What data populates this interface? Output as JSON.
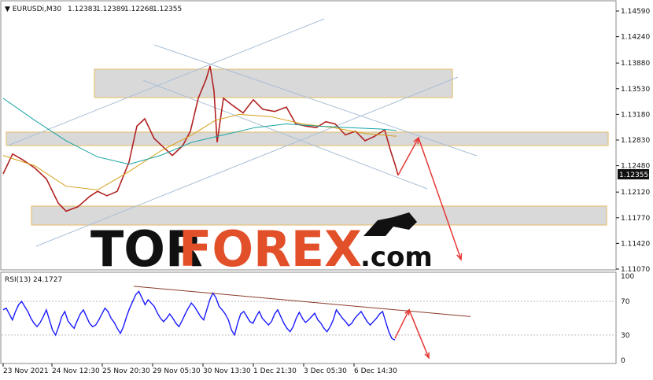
{
  "chart_data": [
    {
      "type": "line",
      "title": "EURUSDi,M30",
      "header": {
        "symbol": "EURUSDi,M30",
        "open": "1.12383",
        "high": "1.12389",
        "low": "1.12268",
        "close": "1.12355"
      },
      "current_price_label": "1.12355",
      "ylim": [
        1.1107,
        1.1459
      ],
      "y_ticks": [
        "1.14590",
        "1.14240",
        "1.13880",
        "1.13530",
        "1.13180",
        "1.12830",
        "1.12480",
        "1.12120",
        "1.11770",
        "1.11420",
        "1.11070"
      ],
      "x_ticks": [
        "23 Nov 2021",
        "24 Nov 12:30",
        "25 Nov 20:30",
        "29 Nov 05:30",
        "30 Nov 13:30",
        "1 Dec 21:30",
        "3 Dec 05:30",
        "6 Dec 14:30"
      ],
      "series": [
        {
          "name": "",
          "kind": "price",
          "color": "#b22222",
          "points": [
            [
              0,
              1.1237
            ],
            [
              12,
              1.1264
            ],
            [
              25,
              1.1256
            ],
            [
              40,
              1.1245
            ],
            [
              55,
              1.123
            ],
            [
              70,
              1.1197
            ],
            [
              80,
              1.1186
            ],
            [
              95,
              1.1192
            ],
            [
              110,
              1.1206
            ],
            [
              120,
              1.1213
            ],
            [
              132,
              1.1207
            ],
            [
              145,
              1.1213
            ],
            [
              160,
              1.1253
            ],
            [
              170,
              1.1302
            ],
            [
              180,
              1.1312
            ],
            [
              192,
              1.1285
            ],
            [
              205,
              1.1272
            ],
            [
              215,
              1.1262
            ],
            [
              228,
              1.1275
            ],
            [
              238,
              1.1295
            ],
            [
              248,
              1.134
            ],
            [
              258,
              1.1366
            ],
            [
              263,
              1.1384
            ],
            [
              268,
              1.135
            ],
            [
              272,
              1.128
            ],
            [
              280,
              1.134
            ],
            [
              292,
              1.133
            ],
            [
              305,
              1.132
            ],
            [
              318,
              1.1338
            ],
            [
              330,
              1.1325
            ],
            [
              345,
              1.1322
            ],
            [
              360,
              1.1328
            ],
            [
              372,
              1.1305
            ],
            [
              385,
              1.1302
            ],
            [
              398,
              1.13
            ],
            [
              410,
              1.1308
            ],
            [
              422,
              1.1305
            ],
            [
              435,
              1.129
            ],
            [
              448,
              1.1295
            ],
            [
              460,
              1.1282
            ],
            [
              472,
              1.1288
            ],
            [
              485,
              1.1297
            ],
            [
              492,
              1.127
            ],
            [
              498,
              1.125
            ],
            [
              502,
              1.1235
            ]
          ]
        },
        {
          "name": "",
          "kind": "ma-fast",
          "color": "#d4a017",
          "points": [
            [
              0,
              1.1262
            ],
            [
              40,
              1.1248
            ],
            [
              80,
              1.122
            ],
            [
              120,
              1.1215
            ],
            [
              160,
              1.124
            ],
            [
              200,
              1.1268
            ],
            [
              240,
              1.129
            ],
            [
              270,
              1.131
            ],
            [
              300,
              1.1318
            ],
            [
              340,
              1.1315
            ],
            [
              380,
              1.1305
            ],
            [
              420,
              1.13
            ],
            [
              460,
              1.1292
            ],
            [
              500,
              1.1288
            ]
          ]
        },
        {
          "name": "",
          "kind": "ma-slow",
          "color": "#1aa3a3",
          "points": [
            [
              0,
              1.134
            ],
            [
              40,
              1.131
            ],
            [
              80,
              1.1282
            ],
            [
              120,
              1.126
            ],
            [
              160,
              1.125
            ],
            [
              200,
              1.1262
            ],
            [
              240,
              1.128
            ],
            [
              280,
              1.129
            ],
            [
              320,
              1.13
            ],
            [
              360,
              1.1305
            ],
            [
              400,
              1.1302
            ],
            [
              440,
              1.13
            ],
            [
              480,
              1.1298
            ],
            [
              500,
              1.1296
            ]
          ]
        }
      ],
      "projection": {
        "color": "#e53935",
        "points": [
          [
            502,
            1.1235
          ],
          [
            528,
            1.1286
          ],
          [
            582,
            1.112
          ]
        ]
      }
    },
    {
      "type": "line",
      "title": "RSI(13) 24.1727",
      "ylim": [
        0,
        100
      ],
      "y_ticks": [
        "100",
        "70",
        "30",
        "0"
      ],
      "series": [
        {
          "name": "RSI(13)",
          "color": "#1a1aff",
          "values": [
            60,
            62,
            55,
            48,
            58,
            66,
            70,
            64,
            58,
            50,
            44,
            40,
            45,
            52,
            60,
            48,
            36,
            30,
            40,
            52,
            58,
            47,
            42,
            38,
            47,
            55,
            60,
            52,
            44,
            40,
            42,
            48,
            55,
            62,
            58,
            50,
            45,
            38,
            32,
            40,
            52,
            62,
            70,
            78,
            82,
            74,
            66,
            72,
            68,
            64,
            56,
            50,
            46,
            50,
            55,
            50,
            44,
            40,
            47,
            55,
            62,
            68,
            64,
            58,
            52,
            48,
            60,
            72,
            80,
            74,
            64,
            60,
            55,
            48,
            36,
            30,
            44,
            55,
            58,
            52,
            46,
            44,
            52,
            58,
            50,
            46,
            42,
            46,
            55,
            60,
            52,
            44,
            38,
            34,
            40,
            50,
            57,
            50,
            45,
            48,
            52,
            56,
            48,
            44,
            38,
            34,
            40,
            48,
            60,
            55,
            50,
            46,
            41,
            44,
            50,
            54,
            58,
            52,
            46,
            42,
            46,
            50,
            55,
            58,
            46,
            34,
            26,
            24
          ]
        }
      ],
      "trendline": {
        "color": "#8b3a2a",
        "from": [
          170,
          88
        ],
        "to": [
          598,
          52
        ]
      },
      "projection": {
        "color": "#e53935",
        "points": [
          [
            502,
            26
          ],
          [
            520,
            60
          ],
          [
            545,
            3
          ]
        ]
      }
    }
  ],
  "overlays": {
    "watermark": "TORFOREX.com",
    "zones_color": "#d9d9d9",
    "zone_border": "#e6c27a",
    "channel_color": "#a9bfd6"
  }
}
